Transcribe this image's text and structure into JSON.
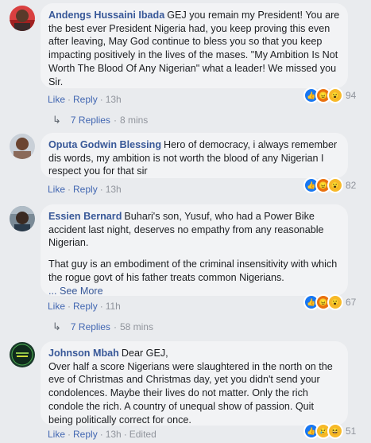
{
  "comments": [
    {
      "author": "Andengs Hussaini Ibada",
      "text": "GEJ you remain my President! You are the best ever President Nigeria had, you keep proving this even after leaving, May God continue to bless you so that you keep impacting positively in the lives of the mases. \"My Ambition Is Not Worth The Blood Of Any Nigerian\" what a leader! We missed you Sir.",
      "like": "Like",
      "reply": "Reply",
      "time": "13h",
      "edited": "",
      "reaction_count": "94",
      "reactions": [
        "like-icon",
        "angry-icon",
        "wow-icon"
      ],
      "replies_label": "7 Replies",
      "replies_time": "8 mins"
    },
    {
      "author": "Oputa Godwin Blessing",
      "text": "Hero of democracy, i always remember dis words, my ambition is not worth the blood of any Nigerian I respect you for that sir",
      "like": "Like",
      "reply": "Reply",
      "time": "13h",
      "reaction_count": "82",
      "reactions": [
        "like-icon",
        "angry-icon",
        "wow-icon"
      ]
    },
    {
      "author": "Essien Bernard",
      "text": "Buhari's son, Yusuf, who had a Power Bike accident last night, deserves no empathy from any reasonable Nigerian.",
      "text2": "That guy is an embodiment of the criminal insensitivity with which the rogue govt of his father treats common Nigerians.",
      "see_more": "... See More",
      "like": "Like",
      "reply": "Reply",
      "time": "11h",
      "reaction_count": "67",
      "reactions": [
        "like-icon",
        "angry-icon",
        "wow-icon"
      ],
      "replies_label": "7 Replies",
      "replies_time": "58 mins"
    },
    {
      "author": "Johnson Mbah",
      "text": "Dear GEJ,\nOver half a score Nigerians were slaughtered in the north on the eve of Christmas and Christmas day, yet you didn't send your condolences. Maybe their lives do not matter. Only the rich condole the rich. A country of unequal show of passion. Quit being politically correct for once.",
      "like": "Like",
      "reply": "Reply",
      "time": "13h",
      "edited": "Edited",
      "reaction_count": "51",
      "reactions": [
        "like-icon",
        "sad-icon",
        "haha-icon"
      ]
    }
  ],
  "colors": {
    "background": "#e9ebee",
    "bubble": "#f2f3f5",
    "author": "#385898",
    "link": "#4267b2",
    "meta": "#90949c"
  }
}
